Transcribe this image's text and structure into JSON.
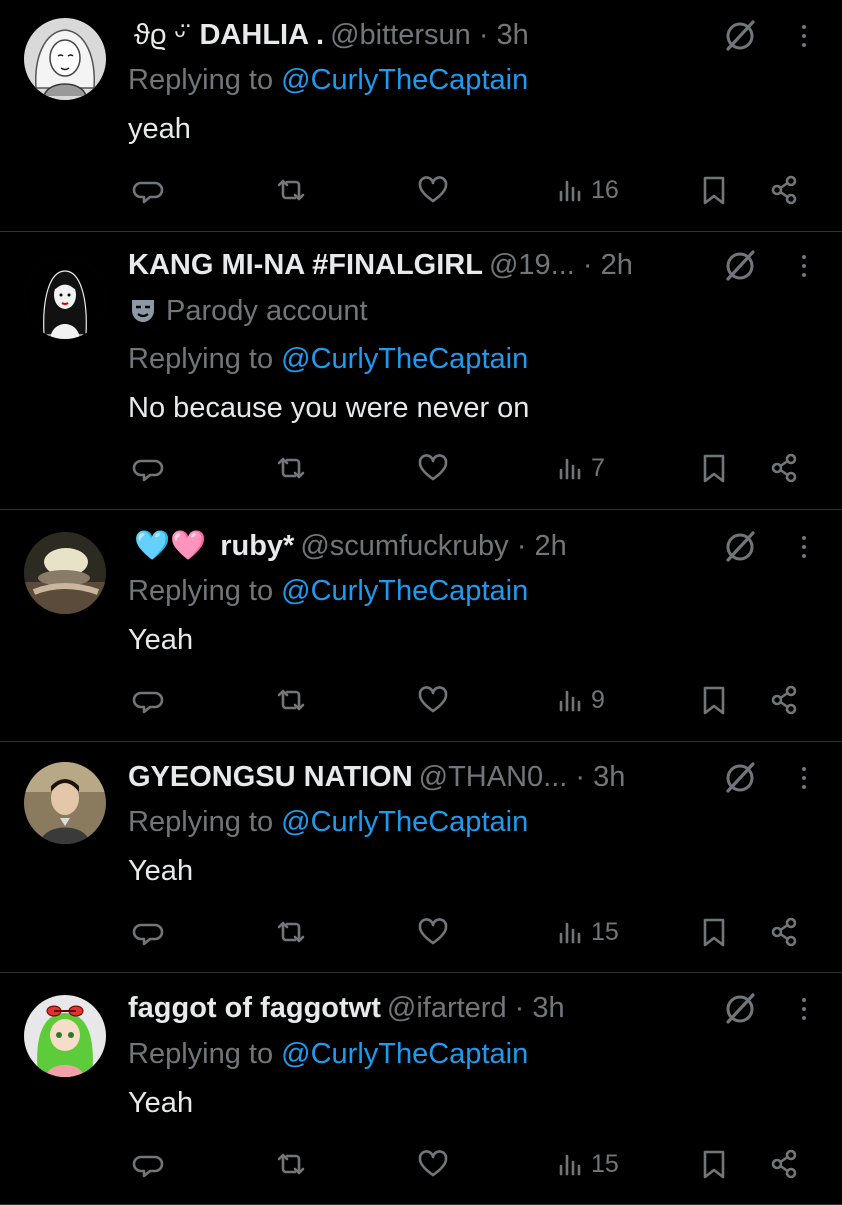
{
  "colors": {
    "background": "#000000",
    "text": "#e7e9ea",
    "muted": "#71767b",
    "link": "#1d9bf0",
    "divider": "#2f3336"
  },
  "icons": {
    "reply": "reply-icon",
    "retweet": "retweet-icon",
    "like": "heart-icon",
    "views": "views-chart-icon",
    "bookmark": "bookmark-icon",
    "share": "share-icon",
    "grok": "grok-icon",
    "more": "more-options-icon"
  },
  "tweets": [
    {
      "name_prefix": "ϑϱ   ᵕ̈",
      "display_name": "DAHLIA .",
      "handle": "@bittersun",
      "sep": "·",
      "time": "3h",
      "parody": "",
      "replying_label": "Replying to",
      "replying_to": "@CurlyTheCaptain",
      "text": "yeah",
      "views": "16"
    },
    {
      "name_prefix": "",
      "display_name": "KANG MI-NA #FINALGIRL",
      "handle": "@19...",
      "sep": "·",
      "time": "2h",
      "parody": "Parody account",
      "replying_label": "Replying to",
      "replying_to": "@CurlyTheCaptain",
      "text": "No because you were never on",
      "views": "7"
    },
    {
      "name_prefix": "🩵🩷",
      "display_name": "ruby*",
      "handle": "@scumfuckruby",
      "sep": "·",
      "time": "2h",
      "parody": "",
      "replying_label": "Replying to",
      "replying_to": "@CurlyTheCaptain",
      "text": "Yeah",
      "views": "9"
    },
    {
      "name_prefix": "",
      "display_name": "GYEONGSU NATION",
      "handle": "@THAN0...",
      "sep": "·",
      "time": "3h",
      "parody": "",
      "replying_label": "Replying to",
      "replying_to": "@CurlyTheCaptain",
      "text": "Yeah",
      "views": "15"
    },
    {
      "name_prefix": "",
      "display_name": "faggot of faggotwt",
      "handle": "@ifarterd",
      "sep": "·",
      "time": "3h",
      "parody": "",
      "replying_label": "Replying to",
      "replying_to": "@CurlyTheCaptain",
      "text": "Yeah",
      "views": "15"
    }
  ]
}
